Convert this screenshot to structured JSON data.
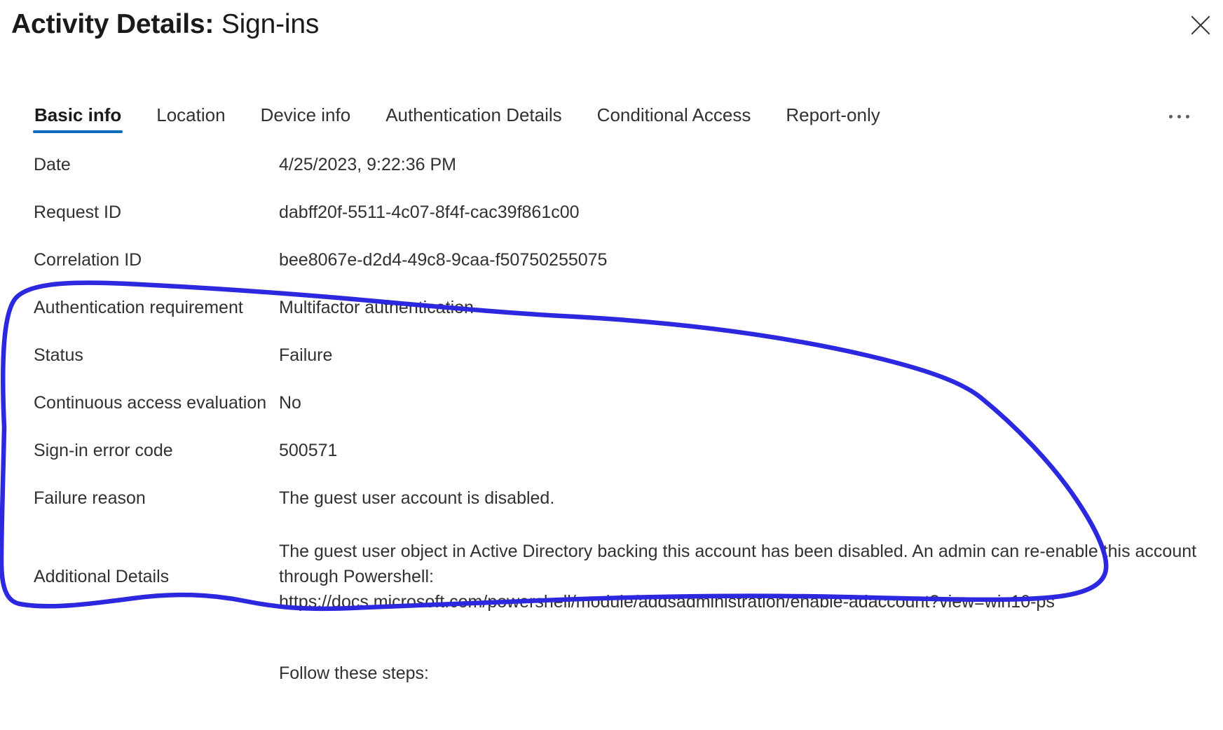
{
  "header": {
    "title_strong": "Activity Details:",
    "title_light": " Sign-ins",
    "close_label": "Close",
    "close_icon": "close-icon"
  },
  "tabs": {
    "items": [
      {
        "label": "Basic info",
        "selected": true
      },
      {
        "label": "Location",
        "selected": false
      },
      {
        "label": "Device info",
        "selected": false
      },
      {
        "label": "Authentication Details",
        "selected": false
      },
      {
        "label": "Conditional Access",
        "selected": false
      },
      {
        "label": "Report-only",
        "selected": false
      }
    ],
    "overflow_label": "More tabs"
  },
  "details": {
    "rows": [
      {
        "label": "Date",
        "value": "4/25/2023, 9:22:36 PM"
      },
      {
        "label": "Request ID",
        "value": "dabff20f-5511-4c07-8f4f-cac39f861c00"
      },
      {
        "label": "Correlation ID",
        "value": "bee8067e-d2d4-49c8-9caa-f50750255075"
      },
      {
        "label": "Authentication requirement",
        "value": "Multifactor authentication"
      },
      {
        "label": "Status",
        "value": "Failure"
      },
      {
        "label": "Continuous access evaluation",
        "value": "No"
      },
      {
        "label": "Sign-in error code",
        "value": "500571"
      },
      {
        "label": "Failure reason",
        "value": "The guest user account is disabled."
      },
      {
        "label": "Additional Details",
        "value": "The guest user object in Active Directory backing this account has been disabled. An admin can re-enable this account through Powershell:\nhttps://docs.microsoft.com/powershell/module/addsadministration/enable-adaccount?view=win10-ps"
      }
    ],
    "trailing_note": "Follow these steps:"
  },
  "annotation": {
    "type": "freehand-circle",
    "color": "#2b28e0"
  },
  "colors": {
    "accent": "#0f6cbd",
    "text": "#323130",
    "title": "#1b1a19",
    "annotation": "#2b28e0",
    "background": "#ffffff"
  }
}
